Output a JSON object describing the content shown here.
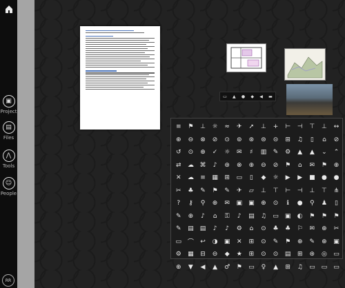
{
  "sidebar": {
    "items": [
      {
        "label": "Project",
        "icon": "briefcase-icon",
        "glyph": "▣"
      },
      {
        "label": "Files",
        "icon": "folder-icon",
        "glyph": "▤"
      },
      {
        "label": "Tools",
        "icon": "compass-icon",
        "glyph": "⋀"
      },
      {
        "label": "People",
        "icon": "people-icon",
        "glyph": "☺"
      }
    ],
    "user_initials": "RR"
  },
  "toolbar_strip": {
    "glyphs": [
      "▭",
      "▲",
      "●",
      "◆",
      "◀",
      "▬"
    ]
  },
  "icon_grid": {
    "glyphs": [
      "≡",
      "⚑",
      "⊥",
      "☼",
      "≈",
      "✈",
      "➚",
      "⊥",
      "+",
      "⊢",
      "⊣",
      "⊤",
      "⊥",
      "↔",
      "⊕",
      "⊖",
      "⊗",
      "⊘",
      "⊙",
      "⊚",
      "⊛",
      "⊜",
      "⊝",
      "⊞",
      "♫",
      "▯",
      "⌂",
      "⊘",
      "↺",
      "⊙",
      "⊕",
      "✓",
      "☼",
      "✉",
      "♯",
      "▥",
      "✎",
      "⚙",
      "▲",
      "▲",
      "⌄",
      "⌃",
      "⇄",
      "☁",
      "⌘",
      "♪",
      "⊛",
      "⊗",
      "⊕",
      "⊖",
      "⊘",
      "⚑",
      "⌂",
      "✉",
      "⚑",
      "⊕",
      "✕",
      "☁",
      "≡",
      "▦",
      "⊞",
      "▭",
      "▯",
      "◆",
      "☼",
      "▶",
      "▶",
      "■",
      "●",
      "●",
      "✂",
      "♣",
      "✎",
      "⚑",
      "✎",
      "✈",
      "▱",
      "⊥",
      "⊤",
      "⊢",
      "⊣",
      "⊥",
      "⊤",
      "⋔",
      "?",
      "⚷",
      "⚲",
      "⊕",
      "✉",
      "▣",
      "▣",
      "⊕",
      "⊙",
      "ℹ",
      "●",
      "⚲",
      "♟",
      "▯",
      "✎",
      "⊕",
      "♪",
      "⌂",
      "⚿",
      "♪",
      "▤",
      "♫",
      "▭",
      "▣",
      "◐",
      "⚑",
      "⚑",
      "⚑",
      "✎",
      "▤",
      "▤",
      "♪",
      "♪",
      "⚙",
      "⌂",
      "⊙",
      "♣",
      "♣",
      "⚐",
      "✉",
      "⊕",
      "✂",
      "▭",
      "⌒",
      "↩",
      "◑",
      "▣",
      "✕",
      "⊞",
      "⊙",
      "✎",
      "⚑",
      "⊕",
      "✎",
      "⊕",
      "▣",
      "⚙",
      "▦",
      "⊟",
      "⊖",
      "◆",
      "★",
      "⊞",
      "⊙",
      "⊙",
      "▤",
      "⊞",
      "⊛",
      "◎",
      "▭",
      "⊕",
      "▼",
      "◀",
      "▲",
      "♂",
      "⚑",
      "▭",
      "♀",
      "▲",
      "⊞",
      "♫",
      "▭",
      "▭",
      "▭"
    ]
  }
}
